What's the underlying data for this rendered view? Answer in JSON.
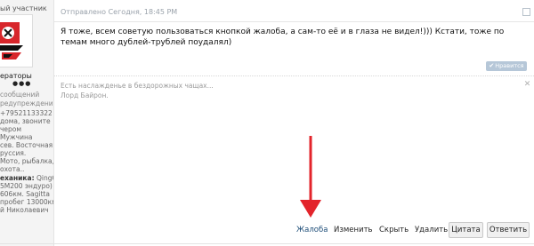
{
  "user_panel": {
    "role": "ый участник",
    "group": "ераторы",
    "pips": "●●●",
    "messages": "сообщений",
    "warnings": "редупреждения",
    "info_lines": [
      "+79521133322",
      "дома, звоните",
      "чером",
      "Мужчина",
      "сев. Восточная",
      "руссия.",
      "Мото, рыбалка,",
      "охота.."
    ],
    "tech_label": "еханика:",
    "tech_value_first": "QingQi",
    "tech_lines": [
      "5М200 эндуро) -",
      "606км. Sagitta",
      "пробег 13000км",
      "й Николаевич"
    ]
  },
  "post": {
    "posted": "Отправлено Сегодня, 18:45 PM",
    "body": "Я тоже, всем советую пользоваться кнопкой жалоба, а сам-то её и в глаза не видел!))) Кстати, тоже по темам много дублей-трублей поудалял)",
    "like_label": "Нравится",
    "signature_line1": "Есть наслажденье в бездорожных чащах...",
    "signature_line2": "Лорд Байрон."
  },
  "controls": {
    "report": "Жалоба",
    "edit": "Изменить",
    "hide": "Скрыть",
    "delete": "Удалить",
    "quote": "Цитата",
    "reply": "Ответить"
  },
  "colors": {
    "link": "#1d4d78",
    "like_bg": "#b6c7d8",
    "arrow": "#e3242b"
  }
}
